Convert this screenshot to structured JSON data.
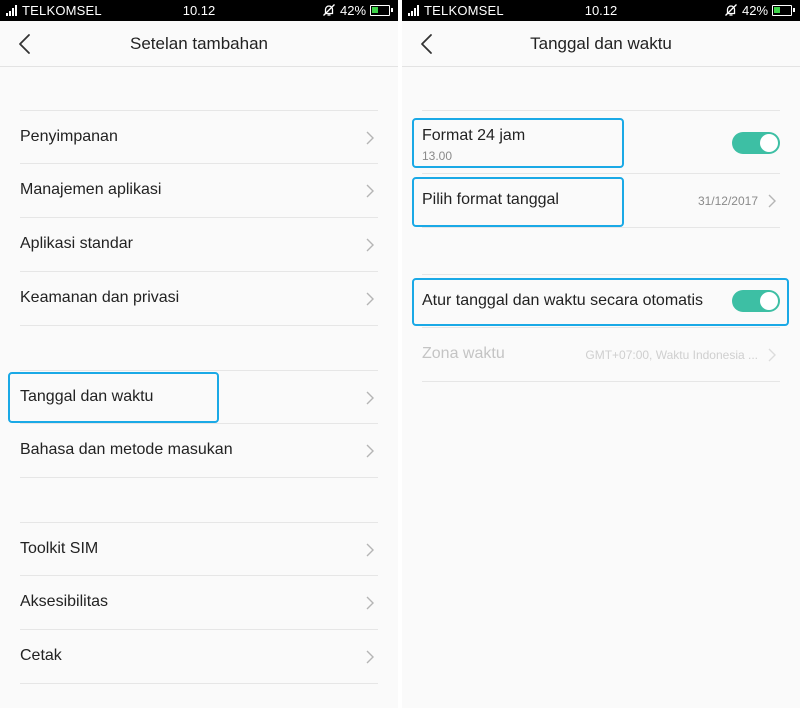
{
  "colors": {
    "accent_toggle": "#3dbfa4",
    "highlight": "#1aa9e6",
    "battery": "#3ed24a"
  },
  "status_bar": {
    "carrier": "TELKOMSEL",
    "time": "10.12",
    "battery_percent": "42%",
    "battery_level": 0.42
  },
  "left": {
    "title": "Setelan tambahan",
    "items": [
      {
        "label": "Penyimpanan"
      },
      {
        "label": "Manajemen aplikasi"
      },
      {
        "label": "Aplikasi standar"
      },
      {
        "label": "Keamanan dan privasi"
      },
      {
        "label": "Tanggal dan waktu"
      },
      {
        "label": "Bahasa dan metode masukan"
      },
      {
        "label": "Toolkit SIM"
      },
      {
        "label": "Aksesibilitas"
      },
      {
        "label": "Cetak"
      }
    ]
  },
  "right": {
    "title": "Tanggal dan waktu",
    "format24": {
      "label": "Format 24 jam",
      "sub": "13.00",
      "on": true
    },
    "date_format": {
      "label": "Pilih format tanggal",
      "value": "31/12/2017"
    },
    "auto_time": {
      "label": "Atur tanggal dan waktu secara otomatis",
      "on": true
    },
    "timezone": {
      "label": "Zona waktu",
      "value": "GMT+07:00, Waktu Indonesia ..."
    }
  }
}
